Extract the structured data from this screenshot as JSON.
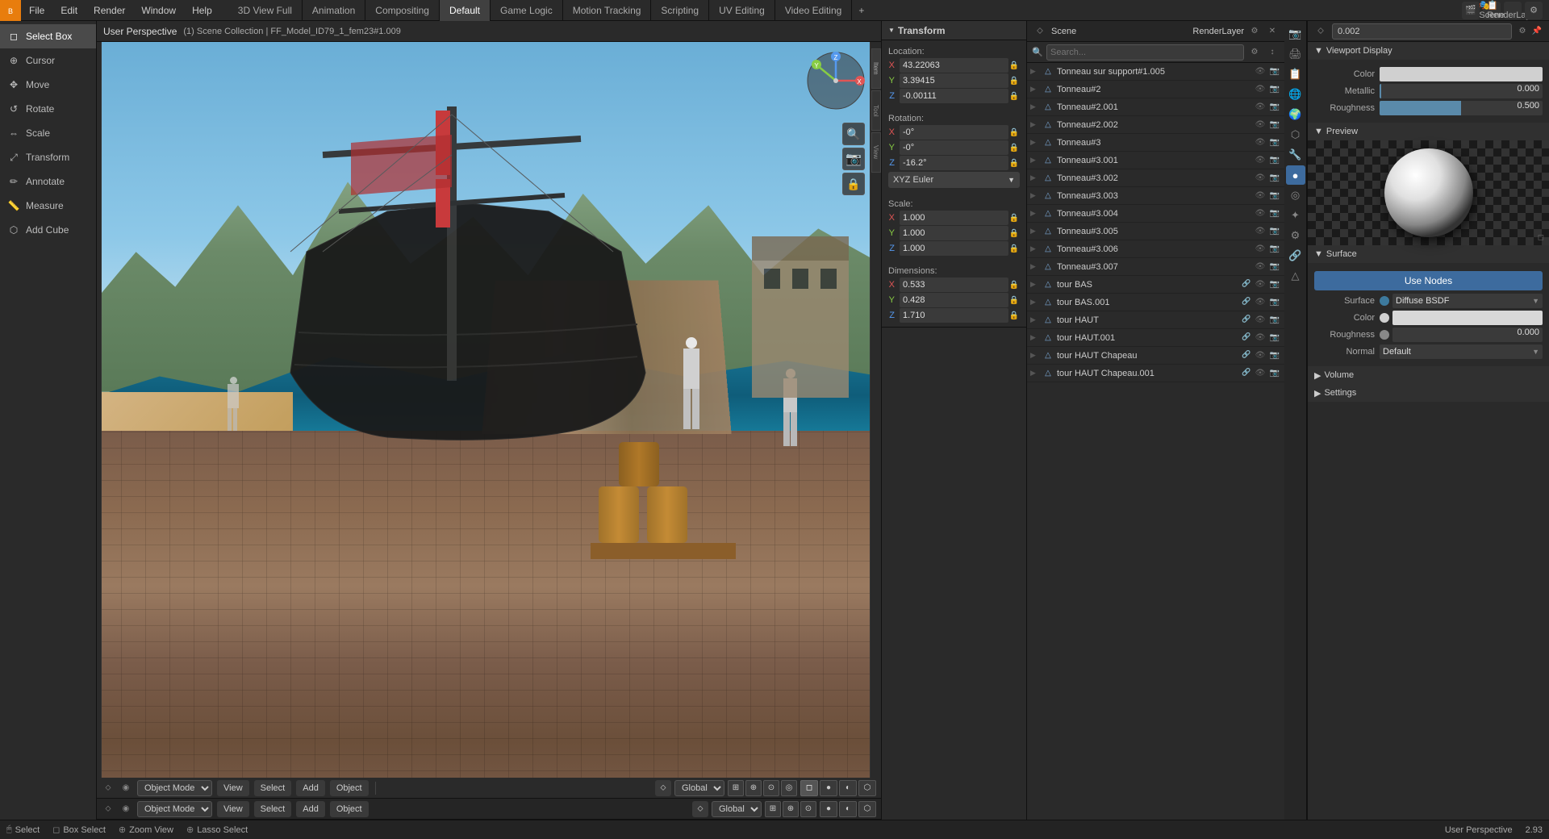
{
  "app": {
    "title": "Blender"
  },
  "menubar": {
    "items": [
      "File",
      "Edit",
      "Render",
      "Window",
      "Help"
    ],
    "workspaces": [
      "3D View Full",
      "Animation",
      "Compositing",
      "Default",
      "Game Logic",
      "Motion Tracking",
      "Scripting",
      "UV Editing",
      "Video Editing"
    ],
    "active_workspace": "Default",
    "add_workspace_label": "+"
  },
  "toolbar": {
    "items": [
      {
        "name": "Select Box",
        "icon": "◻"
      },
      {
        "name": "Cursor",
        "icon": "⊕"
      },
      {
        "name": "Move",
        "icon": "✥"
      },
      {
        "name": "Rotate",
        "icon": "↺"
      },
      {
        "name": "Scale",
        "icon": "⇔"
      },
      {
        "name": "Transform",
        "icon": "⤢"
      },
      {
        "name": "Annotate",
        "icon": "✏"
      },
      {
        "name": "Measure",
        "icon": "📏"
      },
      {
        "name": "Add Cube",
        "icon": "⬡"
      }
    ],
    "active": "Select Box"
  },
  "viewport": {
    "label": "User Perspective",
    "collection": "(1) Scene Collection | FF_Model_ID79_1_fem23#1.009"
  },
  "transform_panel": {
    "title": "Transform",
    "location": {
      "label": "Location:",
      "x_label": "X",
      "x_value": "43.22063",
      "y_label": "Y",
      "y_value": "3.39415",
      "z_label": "Z",
      "z_value": "-0.00111"
    },
    "rotation": {
      "label": "Rotation:",
      "x_label": "X",
      "x_value": "-0°",
      "y_label": "Y",
      "y_value": "-0°",
      "z_label": "Z",
      "z_value": "-16.2°",
      "mode": "XYZ Euler"
    },
    "scale": {
      "label": "Scale:",
      "x_label": "X",
      "x_value": "1.000",
      "y_label": "Y",
      "y_value": "1.000",
      "z_label": "Z",
      "z_value": "1.000"
    },
    "dimensions": {
      "label": "Dimensions:",
      "x_label": "X",
      "x_value": "0.533",
      "y_label": "Y",
      "y_value": "0.428",
      "z_label": "Z",
      "z_value": "1.710"
    }
  },
  "outliner": {
    "search_placeholder": "Search...",
    "scene_label": "Scene",
    "render_layer_label": "RenderLayer",
    "items": [
      {
        "name": "Tonneau sur support#1.005",
        "type": "mesh",
        "level": 0,
        "has_child": false
      },
      {
        "name": "Tonneau#2",
        "type": "mesh",
        "level": 0,
        "has_child": false
      },
      {
        "name": "Tonneau#2.001",
        "type": "mesh",
        "level": 0,
        "has_child": false
      },
      {
        "name": "Tonneau#2.002",
        "type": "mesh",
        "level": 0,
        "has_child": false
      },
      {
        "name": "Tonneau#3",
        "type": "mesh",
        "level": 0,
        "has_child": false
      },
      {
        "name": "Tonneau#3.001",
        "type": "mesh",
        "level": 0,
        "has_child": false
      },
      {
        "name": "Tonneau#3.002",
        "type": "mesh",
        "level": 0,
        "has_child": false
      },
      {
        "name": "Tonneau#3.003",
        "type": "mesh",
        "level": 0,
        "has_child": false
      },
      {
        "name": "Tonneau#3.004",
        "type": "mesh",
        "level": 0,
        "has_child": false
      },
      {
        "name": "Tonneau#3.005",
        "type": "mesh",
        "level": 0,
        "has_child": false
      },
      {
        "name": "Tonneau#3.006",
        "type": "mesh",
        "level": 0,
        "has_child": false
      },
      {
        "name": "Tonneau#3.007",
        "type": "mesh",
        "level": 0,
        "has_child": false
      },
      {
        "name": "tour BAS",
        "type": "mesh",
        "level": 0,
        "has_child": false
      },
      {
        "name": "tour BAS.001",
        "type": "mesh",
        "level": 0,
        "has_child": false
      },
      {
        "name": "tour HAUT",
        "type": "mesh",
        "level": 0,
        "has_child": false
      },
      {
        "name": "tour HAUT.001",
        "type": "mesh",
        "level": 0,
        "has_child": false
      },
      {
        "name": "tour HAUT Chapeau",
        "type": "mesh",
        "level": 0,
        "has_child": false
      },
      {
        "name": "tour HAUT Chapeau.001",
        "type": "mesh",
        "level": 0,
        "has_child": false
      }
    ]
  },
  "properties_panel": {
    "search_value": "0.002",
    "viewport_display_section": "Viewport Display",
    "color_label": "Color",
    "metallic_label": "Metallic",
    "metallic_value": "0.000",
    "roughness_label": "Roughness",
    "roughness_value": "0.500",
    "preview_section": "Preview",
    "surface_section": "Surface",
    "use_nodes_label": "Use Nodes",
    "surface_label": "Surface",
    "surface_value": "Diffuse BSDF",
    "color2_label": "Color",
    "roughness2_label": "Roughness",
    "roughness2_value": "0.000",
    "normal_label": "Normal",
    "normal_value": "Default",
    "volume_section": "Volume",
    "settings_section": "Settings"
  },
  "bottom_bars": [
    {
      "mode_label": "Object Mode",
      "items": [
        "View",
        "Select",
        "Add",
        "Object"
      ],
      "global_label": "Global"
    },
    {
      "mode_label": "Object Mode",
      "items": [
        "View",
        "Select",
        "Add",
        "Object"
      ],
      "global_label": "Global"
    }
  ],
  "status_bar": {
    "select_label": "Select",
    "box_select_label": "Box Select",
    "zoom_label": "Zoom View",
    "lasso_label": "Lasso Select",
    "mode_label": "User Perspective",
    "fps_value": "2.93"
  }
}
